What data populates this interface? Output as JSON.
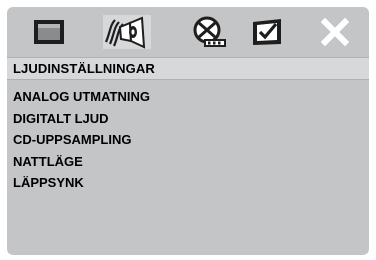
{
  "icons": [
    {
      "name": "general-setup",
      "icon": "screen-icon"
    },
    {
      "name": "audio-setup",
      "icon": "speaker-icon",
      "active": true
    },
    {
      "name": "video-setup",
      "icon": "video-reel-icon"
    },
    {
      "name": "preference-setup",
      "icon": "checkbox-icon"
    },
    {
      "name": "exit",
      "icon": "close-icon"
    }
  ],
  "header": {
    "title": "LJUDINSTÄLLNINGAR"
  },
  "menu": {
    "items": [
      {
        "label": "ANALOG UTMATNING"
      },
      {
        "label": "DIGITALT LJUD"
      },
      {
        "label": "CD-UPPSAMPLING"
      },
      {
        "label": "NATTLÄGE"
      },
      {
        "label": "LÄPPSYNK"
      }
    ]
  },
  "colors": {
    "panel": "#c4c5c7",
    "header_bar": "#d7d8da",
    "text": "#000000",
    "icon_dark": "#1e1e1e",
    "icon_light": "#ffffff"
  }
}
